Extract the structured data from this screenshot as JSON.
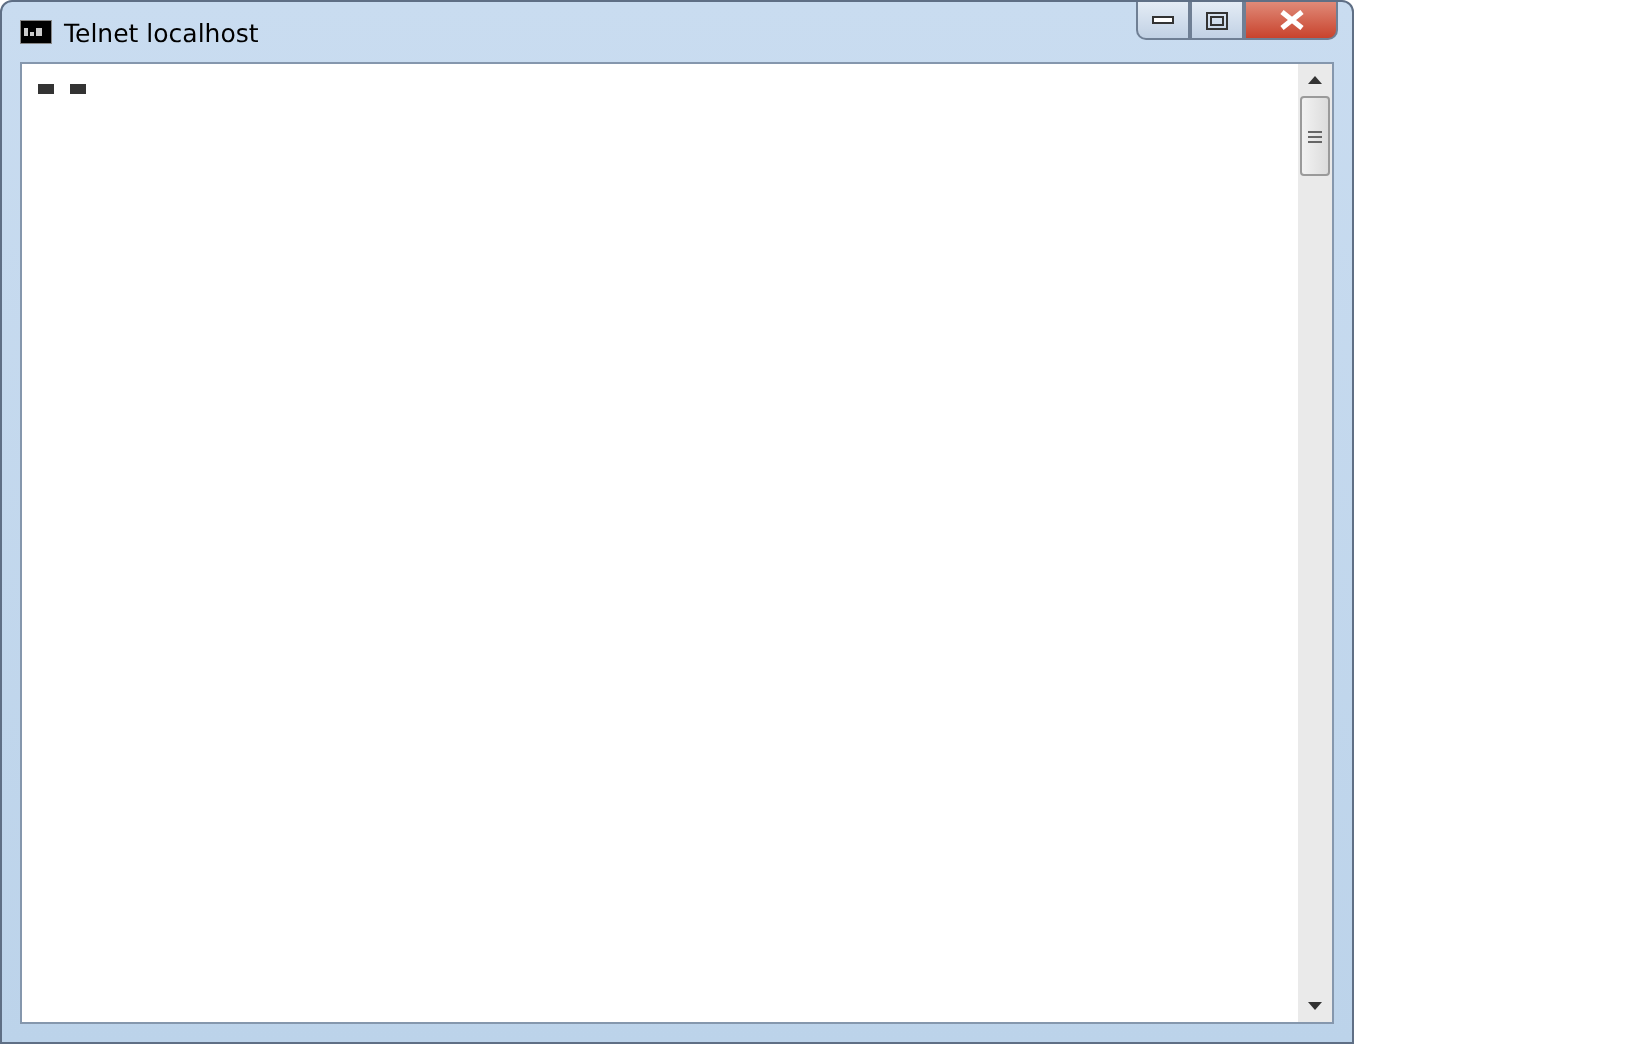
{
  "window": {
    "title": "Telnet localhost"
  }
}
